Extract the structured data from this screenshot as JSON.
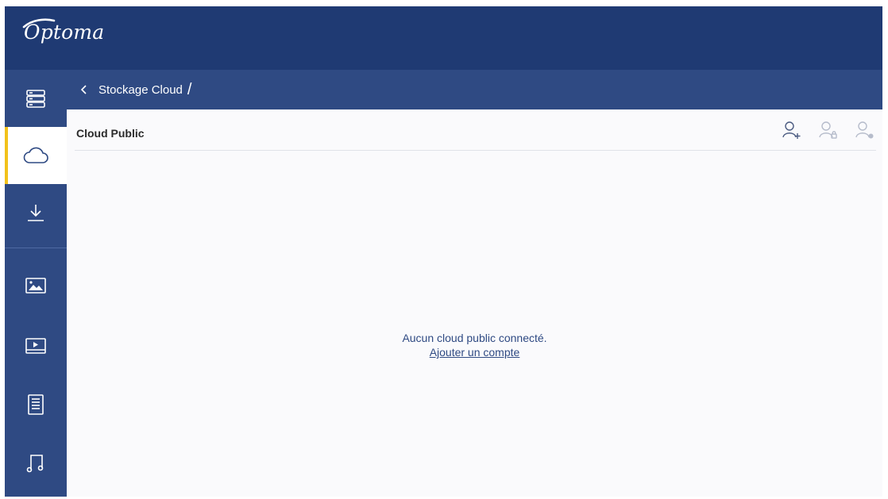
{
  "brand": {
    "logo_text": "Optoma"
  },
  "colors": {
    "topbar": "#1f3a73",
    "sidebar": "#2f4a83",
    "accent": "#f2c21b",
    "link": "#2f4a83"
  },
  "sidebar": {
    "items": [
      {
        "icon": "storage-icon",
        "active": false
      },
      {
        "icon": "cloud-icon",
        "active": true
      },
      {
        "icon": "download-icon",
        "active": false
      },
      {
        "icon": "image-icon",
        "active": false
      },
      {
        "icon": "video-icon",
        "active": false
      },
      {
        "icon": "document-icon",
        "active": false
      },
      {
        "icon": "music-icon",
        "active": false
      }
    ]
  },
  "breadcrumb": {
    "back_icon": "chevron-left-icon",
    "current": "Stockage Cloud",
    "separator": "/"
  },
  "section": {
    "title": "Cloud Public"
  },
  "account_actions": [
    {
      "icon": "add-user-icon",
      "enabled": true
    },
    {
      "icon": "lock-user-icon",
      "enabled": false
    },
    {
      "icon": "remove-user-icon",
      "enabled": false
    }
  ],
  "empty_state": {
    "message": "Aucun cloud public connecté.",
    "link_label": "Ajouter un compte"
  }
}
